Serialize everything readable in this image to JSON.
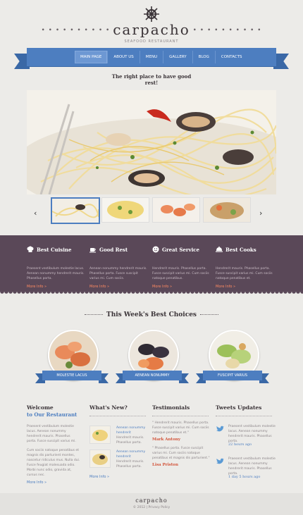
{
  "brand": {
    "logo": "carpacho",
    "tagline": "SEAFOOD RESTAURANT",
    "slogan": "The right place to have good rest!"
  },
  "nav": {
    "items": [
      "MAIN PAGE",
      "ABOUT US",
      "MENU",
      "GALLERY",
      "BLOG",
      "CONTACTS"
    ],
    "active_index": 0
  },
  "slider": {
    "prev_arrow": "‹",
    "next_arrow": "›",
    "thumbs_count": 4,
    "active_thumb": 0
  },
  "features": [
    {
      "title": "Best Cuisine",
      "icon": "chef-hat-icon",
      "text": "Praesent vestibulum molestie lacus. Aenean nonummy hendrerit mauris. Phasellus porta.",
      "more": "More Info »"
    },
    {
      "title": "Good Rest",
      "icon": "coffee-cup-icon",
      "text": "Aenean nonummy hendrerit mauris. Phasellus porta. Fusce suscipit varius mi. Cum sociis.",
      "more": "More Info »"
    },
    {
      "title": "Great Service",
      "icon": "smiley-icon",
      "text": "Hendrerit mauris. Phasellus porta. Fusce suscipit varius mi. Cum sociis natoque penatibus.",
      "more": "More Info »"
    },
    {
      "title": "Best Cooks",
      "icon": "cloche-icon",
      "text": "Hendrerit mauris. Phasellus porta. Fusce suscipit varius mi. Cum sociis natoque penatibus et.",
      "more": "More Info »"
    }
  ],
  "choices": {
    "title": "This Week's Best Choices",
    "items": [
      {
        "label": "MOLESTIE LACUS"
      },
      {
        "label": "AENEAN NONUMMY"
      },
      {
        "label": "FUSCIPIT VARIUS"
      }
    ]
  },
  "welcome": {
    "title": "Welcome",
    "subtitle": "to Our Restaurant",
    "para1": "Praesent vestibulum molestie lacus. Aenean nonummy hendrerit mauris. Phasellus porta. Fusce suscipit varius mi.",
    "para2": "Cum sociis natoque penatibus et magnis dis parturient montes, nascetur ridiculus mus. Nulla dui. Fusce feugiat malesuada odio. Morbi nunc odio, gravida at, cursus nec.",
    "more": "More Info »"
  },
  "news": {
    "title": "What's New?",
    "items": [
      {
        "headline": "Aenean nonummy hendrerit",
        "text": "Hendrerit mauris. Phasellus porta."
      },
      {
        "headline": "Aenean nonummy hendrerit",
        "text": "Hendrerit mauris. Phasellus porta."
      }
    ],
    "more": "More Info »"
  },
  "testimonials": {
    "title": "Testimonials",
    "items": [
      {
        "quote": "\" Hendrerit mauris. Phasellus porta. Fusce suscipit varius mi. Cum sociis natoque penatibus et.\"",
        "author": "Mark Antony"
      },
      {
        "quote": "\" Phasellus porta. Fusce suscipit varius mi. Cum sociis natoque penatibus et magnis dis parturient.\"",
        "author": "Lisa Priston"
      }
    ]
  },
  "tweets": {
    "title": "Tweets Updates",
    "items": [
      {
        "text": "Praesent vestibulum molestie lacus. Aenean nonummy hendrerit mauris. Phasellus porta.",
        "time": "22 hours ago"
      },
      {
        "text": "Praesent vestibulum molestie lacus. Aenean nonummy hendrerit mauris. Phasellus porta.",
        "time": "1 day 5 hours ago"
      }
    ]
  },
  "footer": {
    "logo": "carpacho",
    "copyright": "© 2012 | Privacy Policy"
  },
  "colors": {
    "accent_blue": "#4d7ec0",
    "plum": "#5a4858",
    "orange": "#ff8a62",
    "background": "#ecebe8"
  }
}
